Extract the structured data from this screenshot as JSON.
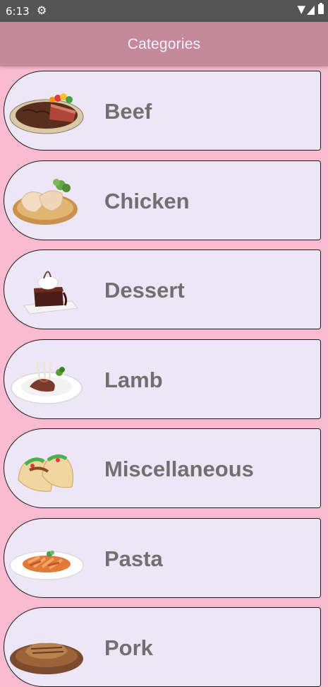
{
  "status_bar": {
    "time": "6:13"
  },
  "app_bar": {
    "title": "Categories"
  },
  "categories": [
    {
      "label": "Beef",
      "icon": "beef-steak-icon"
    },
    {
      "label": "Chicken",
      "icon": "chicken-icon"
    },
    {
      "label": "Dessert",
      "icon": "dessert-icon"
    },
    {
      "label": "Lamb",
      "icon": "lamb-chops-icon"
    },
    {
      "label": "Miscellaneous",
      "icon": "tacos-icon"
    },
    {
      "label": "Pasta",
      "icon": "pasta-icon"
    },
    {
      "label": "Pork",
      "icon": "pork-chop-icon"
    }
  ],
  "colors": {
    "background": "#f8bbd0",
    "app_bar": "#c4899a",
    "card": "#ede6f6",
    "label_text": "#707070"
  }
}
